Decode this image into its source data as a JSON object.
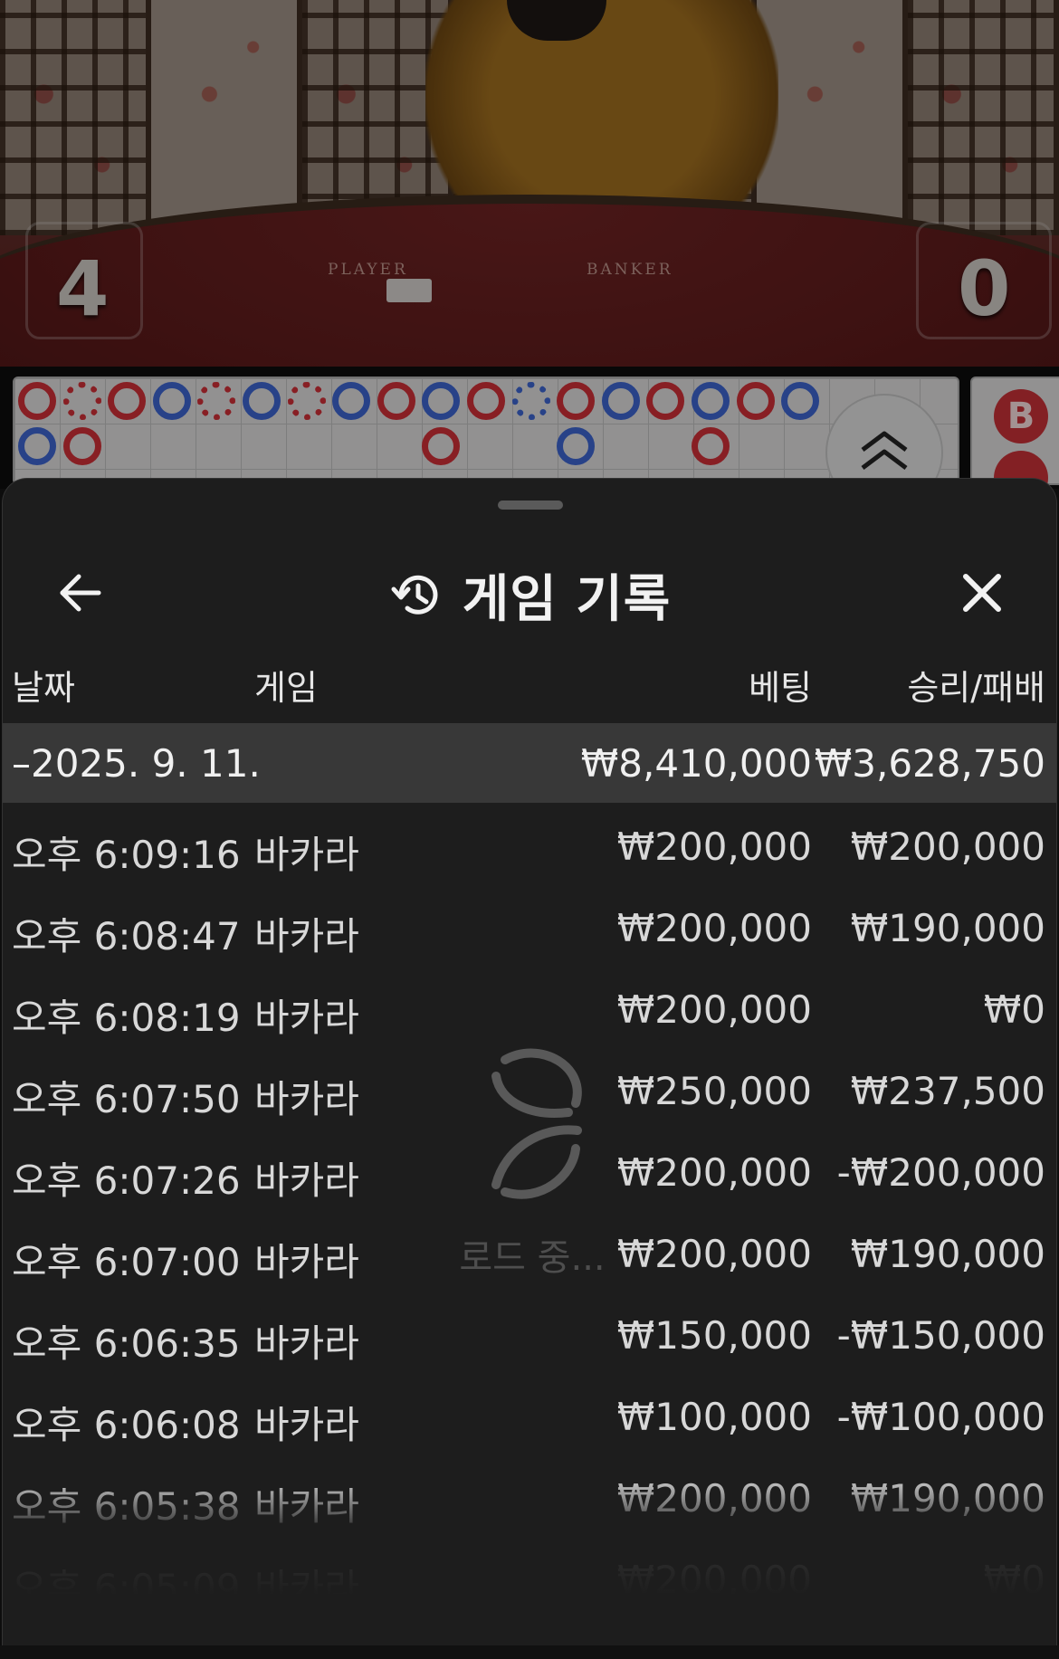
{
  "video": {
    "player_label": "PLAYER",
    "banker_label": "BANKER",
    "player_score": "4",
    "banker_score": "0"
  },
  "roadmap": {
    "bead_rows": [
      [
        "partial-red",
        "gap-red",
        "red",
        "blue",
        "gap-red",
        "blue",
        "gap-red",
        "blue",
        "red",
        "blue",
        "red",
        "gap-blue",
        "red",
        "blue",
        "red",
        "blue",
        "red",
        "blue"
      ],
      [
        "blue",
        "red",
        "",
        "",
        "",
        "",
        "",
        "",
        "",
        "red",
        "",
        "",
        "blue",
        "",
        "",
        "red",
        "",
        ""
      ]
    ],
    "big_road_chip": "B",
    "colors": {
      "banker": "#c92f35",
      "player": "#3b62c9"
    }
  },
  "sheet": {
    "title": "게임 기록",
    "columns": {
      "date": "날짜",
      "game": "게임",
      "bet": "베팅",
      "win_loss": "승리/패배"
    },
    "summary": {
      "date": "–2025. 9. 11.",
      "bet": "₩8,410,000",
      "win_loss": "₩3,628,750"
    },
    "rows": [
      {
        "time": "오후 6:09:16",
        "game": "바카라",
        "bet": "₩200,000",
        "win_loss": "₩200,000"
      },
      {
        "time": "오후 6:08:47",
        "game": "바카라",
        "bet": "₩200,000",
        "win_loss": "₩190,000"
      },
      {
        "time": "오후 6:08:19",
        "game": "바카라",
        "bet": "₩200,000",
        "win_loss": "₩0"
      },
      {
        "time": "오후 6:07:50",
        "game": "바카라",
        "bet": "₩250,000",
        "win_loss": "₩237,500"
      },
      {
        "time": "오후 6:07:26",
        "game": "바카라",
        "bet": "₩200,000",
        "win_loss": "-₩200,000"
      },
      {
        "time": "오후 6:07:00",
        "game": "바카라",
        "bet": "₩200,000",
        "win_loss": "₩190,000"
      },
      {
        "time": "오후 6:06:35",
        "game": "바카라",
        "bet": "₩150,000",
        "win_loss": "-₩150,000"
      },
      {
        "time": "오후 6:06:08",
        "game": "바카라",
        "bet": "₩100,000",
        "win_loss": "-₩100,000"
      },
      {
        "time": "오후 6:05:38",
        "game": "바카라",
        "bet": "₩200,000",
        "win_loss": "₩190,000"
      },
      {
        "time": "오후 6:05:09",
        "game": "바카라",
        "bet": "₩200,000",
        "win_loss": "₩0"
      }
    ],
    "loading_text": "로드 중..."
  }
}
